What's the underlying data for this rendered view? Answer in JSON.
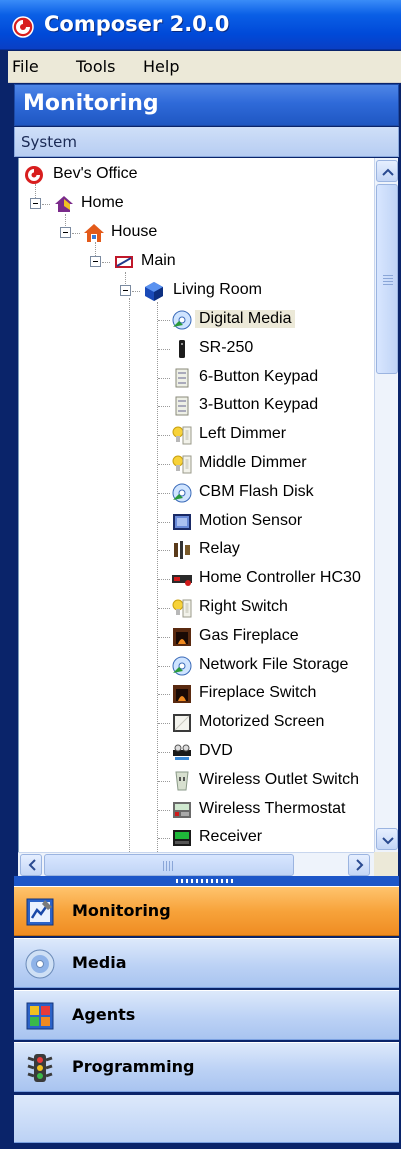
{
  "window": {
    "title": "Composer 2.0.0"
  },
  "menu": {
    "items": [
      "File",
      "Tools",
      "Help"
    ]
  },
  "section": {
    "title": "Monitoring",
    "subheader": "System"
  },
  "tree": {
    "root": "Bev's Office",
    "home": "Home",
    "house": "House",
    "floor": "Main",
    "room": "Living Room",
    "devices": [
      {
        "label": "Digital Media",
        "icon": "digital-media-icon"
      },
      {
        "label": "SR-250",
        "icon": "remote-icon"
      },
      {
        "label": "6-Button Keypad",
        "icon": "keypad-icon"
      },
      {
        "label": "3-Button Keypad",
        "icon": "keypad-icon"
      },
      {
        "label": "Left Dimmer",
        "icon": "dimmer-icon"
      },
      {
        "label": "Middle Dimmer",
        "icon": "dimmer-icon"
      },
      {
        "label": "CBM Flash Disk",
        "icon": "digital-media-icon"
      },
      {
        "label": "Motion Sensor",
        "icon": "motion-sensor-icon"
      },
      {
        "label": "Relay",
        "icon": "relay-icon"
      },
      {
        "label": "Home Controller HC30",
        "icon": "controller-icon"
      },
      {
        "label": "Right Switch",
        "icon": "dimmer-icon"
      },
      {
        "label": "Gas Fireplace",
        "icon": "fireplace-icon"
      },
      {
        "label": "Network File Storage",
        "icon": "digital-media-icon"
      },
      {
        "label": "Fireplace Switch",
        "icon": "fireplace-icon"
      },
      {
        "label": "Motorized Screen",
        "icon": "screen-icon"
      },
      {
        "label": "DVD",
        "icon": "dvd-icon"
      },
      {
        "label": "Wireless Outlet Switch",
        "icon": "outlet-icon"
      },
      {
        "label": "Wireless Thermostat",
        "icon": "thermostat-icon"
      },
      {
        "label": "Receiver",
        "icon": "receiver-icon"
      }
    ],
    "selected_index": 0
  },
  "nav": {
    "items": [
      {
        "label": "Monitoring",
        "icon": "monitoring-icon",
        "active": true
      },
      {
        "label": "Media",
        "icon": "media-disc-icon",
        "active": false
      },
      {
        "label": "Agents",
        "icon": "agents-icon",
        "active": false
      },
      {
        "label": "Programming",
        "icon": "traffic-light-icon",
        "active": false
      }
    ]
  },
  "colors": {
    "title_bar": "#0a5fe6",
    "active_nav": "#f7a33b",
    "selection": "#ece9d8"
  }
}
